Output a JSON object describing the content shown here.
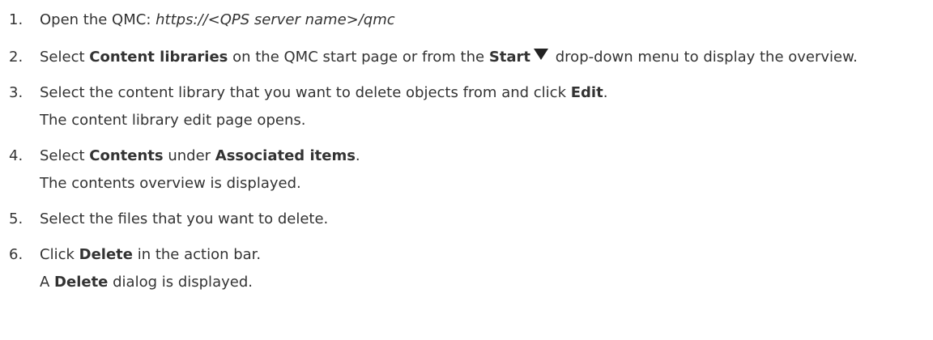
{
  "steps": [
    {
      "num": "1.",
      "text": "Open the QMC: ",
      "url": "https://<QPS server name>/qmc"
    },
    {
      "num": "2.",
      "t1": "Select ",
      "b1": "Content libraries",
      "t2": " on the QMC start page or from the ",
      "b2": "Start",
      "t3": " drop-down menu to display the overview.",
      "icon": "triangle-down-icon"
    },
    {
      "num": "3.",
      "t1": "Select the content library that you want to delete objects from and click ",
      "b1": "Edit",
      "t2": ".",
      "line2": "The content library edit page opens."
    },
    {
      "num": "4.",
      "t1": "Select ",
      "b1": "Contents",
      "t2": " under ",
      "b2": "Associated items",
      "t3": ".",
      "line2": "The contents overview is displayed."
    },
    {
      "num": "5.",
      "text": "Select the files that you want to delete."
    },
    {
      "num": "6.",
      "t1": "Click ",
      "b1": "Delete",
      "t2": " in the action bar.",
      "l2a": "A ",
      "l2b": "Delete",
      "l2c": " dialog is displayed."
    }
  ]
}
